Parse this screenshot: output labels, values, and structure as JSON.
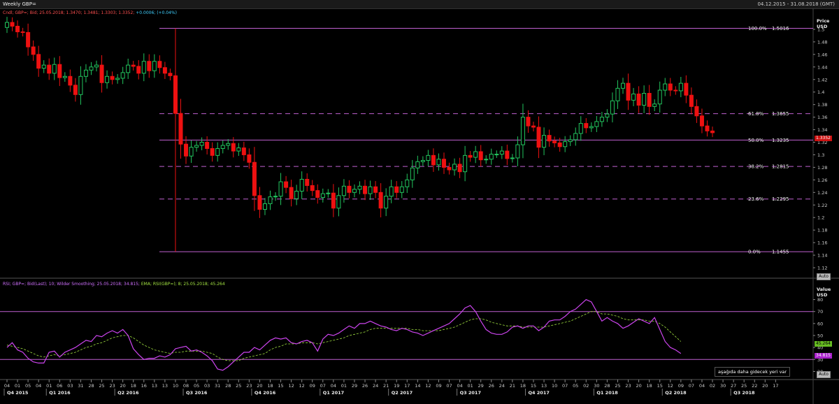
{
  "window": {
    "title": "Weekly GBP=",
    "date_range": "04.12.2015 - 31.08.2018 (GMT)"
  },
  "price_legend": {
    "ohlc": "Cndl; GBP=; Bid; 25.05.2018; 1.3470; 1.3481; 1.3303; 1.3352;",
    "change": "+0.0006; (+0.04%)"
  },
  "rsi_legend": {
    "rsi": "RSI; GBP=; Bid(Last); 10; Wilder Smoothing; 25.05.2018; 34.815;",
    "ema": "EMA; RSI(GBP=); 8; 25.05.2018; 45.264"
  },
  "price_axis": {
    "label_top": "Price",
    "label_unit": "USD",
    "auto": "Auto",
    "last_tag": "1.3352",
    "ticks": [
      "1.5",
      "1.48",
      "1.46",
      "1.44",
      "1.42",
      "1.4",
      "1.38",
      "1.36",
      "1.34",
      "1.32",
      "1.3",
      "1.28",
      "1.26",
      "1.24",
      "1.22",
      "1.2",
      "1.18",
      "1.16",
      "1.14",
      "1.12"
    ]
  },
  "rsi_axis": {
    "label_top": "Value",
    "label_unit": "USD",
    "auto": "Auto",
    "ema_tag": "45.264",
    "rsi_tag": "34.815",
    "ticks": [
      "80",
      "70",
      "60",
      "50",
      "40",
      "30",
      "20"
    ]
  },
  "annotation": "aşağıda daha gidecek yeri var",
  "colors": {
    "up": "#22c55e",
    "down": "#ee1111",
    "fib": "#c060d0",
    "rsi": "#cc44ee",
    "ema": "#a0e040",
    "background": "#000000"
  },
  "x_axis": {
    "days": [
      "04",
      "18",
      "01",
      "22",
      "05",
      "19",
      "04",
      "18",
      "01",
      "22",
      "06",
      "20",
      "03",
      "17",
      "31",
      "14",
      "28",
      "11",
      "25",
      "09",
      "23",
      "06",
      "20",
      "04",
      "18",
      "02",
      "16",
      "30",
      "13",
      "27",
      "13",
      "27",
      "10",
      "24",
      "08",
      "22",
      "05",
      "19",
      "03",
      "17",
      "31",
      "14",
      "28",
      "11",
      "25",
      "09",
      "23",
      "06",
      "20",
      "04",
      "18",
      "01",
      "15",
      "29",
      "12",
      "26",
      "12",
      "26",
      "09",
      "23",
      "07",
      "21",
      "04",
      "18",
      "01",
      "15",
      "29",
      "12",
      "26",
      "10",
      "24",
      "07",
      "21",
      "05",
      "19",
      "03",
      "17",
      "31",
      "14",
      "28",
      "12",
      "26",
      "09",
      "23",
      "07",
      "21",
      "04",
      "18",
      "01",
      "15",
      "29",
      "12",
      "26",
      "10",
      "24",
      "07",
      "21",
      "04",
      "18",
      "01",
      "15",
      "29",
      "13",
      "27",
      "10",
      "24",
      "07",
      "21",
      "05",
      "19",
      "02",
      "16",
      "30",
      "14",
      "28",
      "11",
      "25",
      "09",
      "23",
      "06",
      "20",
      "04",
      "18",
      "01",
      "15",
      "29",
      "12",
      "26",
      "09",
      "23",
      "07",
      "21",
      "04",
      "18",
      "02",
      "16",
      "30",
      "13",
      "27",
      "11",
      "25",
      "08",
      "22",
      "06",
      "20",
      "03",
      "17"
    ],
    "quarters": [
      {
        "label": "Q4 2015",
        "week": 0
      },
      {
        "label": "Q1 2016",
        "week": 8
      },
      {
        "label": "Q2 2016",
        "week": 21
      },
      {
        "label": "Q3 2016",
        "week": 34
      },
      {
        "label": "Q4 2016",
        "week": 47
      },
      {
        "label": "Q1 2017",
        "week": 60
      },
      {
        "label": "Q2 2017",
        "week": 73
      },
      {
        "label": "Q3 2017",
        "week": 86
      },
      {
        "label": "Q4 2017",
        "week": 99
      },
      {
        "label": "Q1 2018",
        "week": 112
      },
      {
        "label": "Q2 2018",
        "week": 125
      },
      {
        "label": "Q3 2018",
        "week": 138
      }
    ]
  },
  "chart_data": [
    {
      "type": "candlestick",
      "title": "Weekly GBP=",
      "ylabel": "Price USD",
      "ylim": [
        1.11,
        1.52
      ],
      "fib_levels": [
        {
          "label": "100.0%",
          "value": 1.5016
        },
        {
          "label": "61.8%",
          "value": 1.3655
        },
        {
          "label": "50.0%",
          "value": 1.3235
        },
        {
          "label": "38.2%",
          "value": 1.2815
        },
        {
          "label": "23.6%",
          "value": 1.2295
        },
        {
          "label": "0.0%",
          "value": 1.1455
        }
      ],
      "fib_values_text": [
        "1.5016",
        "1.3655",
        "1.3235",
        "1.2815",
        "1.2295",
        "1.1455"
      ],
      "close": [
        1.511,
        1.505,
        1.496,
        1.495,
        1.472,
        1.46,
        1.438,
        1.443,
        1.43,
        1.444,
        1.423,
        1.425,
        1.411,
        1.396,
        1.425,
        1.435,
        1.44,
        1.443,
        1.415,
        1.425,
        1.42,
        1.422,
        1.431,
        1.443,
        1.441,
        1.43,
        1.449,
        1.434,
        1.449,
        1.439,
        1.43,
        1.426,
        1.366,
        1.317,
        1.298,
        1.312,
        1.315,
        1.32,
        1.31,
        1.299,
        1.31,
        1.315,
        1.318,
        1.306,
        1.311,
        1.3,
        1.288,
        1.235,
        1.213,
        1.222,
        1.233,
        1.234,
        1.257,
        1.248,
        1.23,
        1.242,
        1.261,
        1.251,
        1.243,
        1.232,
        1.238,
        1.239,
        1.215,
        1.235,
        1.25,
        1.24,
        1.245,
        1.25,
        1.238,
        1.249,
        1.24,
        1.215,
        1.234,
        1.249,
        1.24,
        1.249,
        1.26,
        1.279,
        1.289,
        1.291,
        1.299,
        1.284,
        1.293,
        1.28,
        1.276,
        1.285,
        1.273,
        1.299,
        1.296,
        1.305,
        1.292,
        1.293,
        1.301,
        1.301,
        1.306,
        1.294,
        1.295,
        1.316,
        1.36,
        1.346,
        1.344,
        1.312,
        1.331,
        1.322,
        1.319,
        1.313,
        1.321,
        1.324,
        1.334,
        1.35,
        1.343,
        1.345,
        1.353,
        1.36,
        1.365,
        1.386,
        1.406,
        1.414,
        1.387,
        1.397,
        1.379,
        1.398,
        1.377,
        1.381,
        1.403,
        1.413,
        1.403,
        1.402,
        1.414,
        1.395,
        1.377,
        1.362,
        1.346,
        1.338,
        1.3352
      ]
    },
    {
      "type": "line",
      "title": "RSI",
      "ylabel": "Value USD",
      "ylim": [
        15,
        85
      ],
      "hlines": [
        70,
        30
      ],
      "series": [
        {
          "name": "RSI",
          "values": [
            40,
            44,
            38,
            36,
            31,
            28,
            27,
            27,
            36,
            37,
            32,
            36,
            38,
            40,
            43,
            46,
            45,
            50,
            49,
            52,
            54,
            52,
            55,
            50,
            39,
            34,
            30,
            31,
            31,
            33,
            32,
            34,
            39,
            40,
            41,
            37,
            38,
            36,
            33,
            29,
            22,
            21,
            24,
            28,
            32,
            36,
            36,
            40,
            38,
            42,
            46,
            48,
            47,
            48,
            44,
            43,
            45,
            46,
            44,
            37,
            47,
            51,
            50,
            52,
            55,
            58,
            56,
            60,
            60,
            62,
            60,
            58,
            57,
            55,
            54,
            56,
            55,
            53,
            52,
            50,
            52,
            54,
            56,
            58,
            60,
            64,
            68,
            73,
            75,
            70,
            62,
            55,
            52,
            51,
            51,
            53,
            57,
            58,
            56,
            58,
            58,
            54,
            57,
            62,
            63,
            63,
            66,
            70,
            72,
            76,
            80,
            78,
            70,
            62,
            65,
            62,
            60,
            56,
            58,
            61,
            64,
            62,
            60,
            65,
            55,
            45,
            40,
            38,
            35
          ]
        },
        {
          "name": "EMA",
          "values": [
            42,
            41,
            40,
            39,
            37,
            35,
            33,
            32,
            33,
            34,
            33,
            34,
            35,
            36,
            38,
            40,
            41,
            43,
            44,
            46,
            48,
            49,
            50,
            50,
            48,
            45,
            42,
            40,
            38,
            37,
            36,
            35,
            36,
            36,
            37,
            37,
            37,
            37,
            36,
            35,
            32,
            30,
            29,
            29,
            29,
            31,
            32,
            33,
            34,
            35,
            38,
            40,
            41,
            43,
            43,
            43,
            44,
            44,
            44,
            43,
            44,
            45,
            46,
            47,
            48,
            50,
            51,
            52,
            53,
            55,
            56,
            56,
            56,
            56,
            56,
            56,
            56,
            55,
            55,
            54,
            54,
            54,
            54,
            55,
            56,
            57,
            59,
            61,
            63,
            64,
            64,
            63,
            61,
            60,
            59,
            58,
            58,
            58,
            57,
            57,
            57,
            57,
            57,
            58,
            59,
            60,
            61,
            62,
            64,
            66,
            68,
            70,
            70,
            68,
            68,
            67,
            66,
            64,
            63,
            63,
            63,
            63,
            62,
            62,
            60,
            57,
            53,
            49,
            45
          ]
        }
      ]
    }
  ]
}
